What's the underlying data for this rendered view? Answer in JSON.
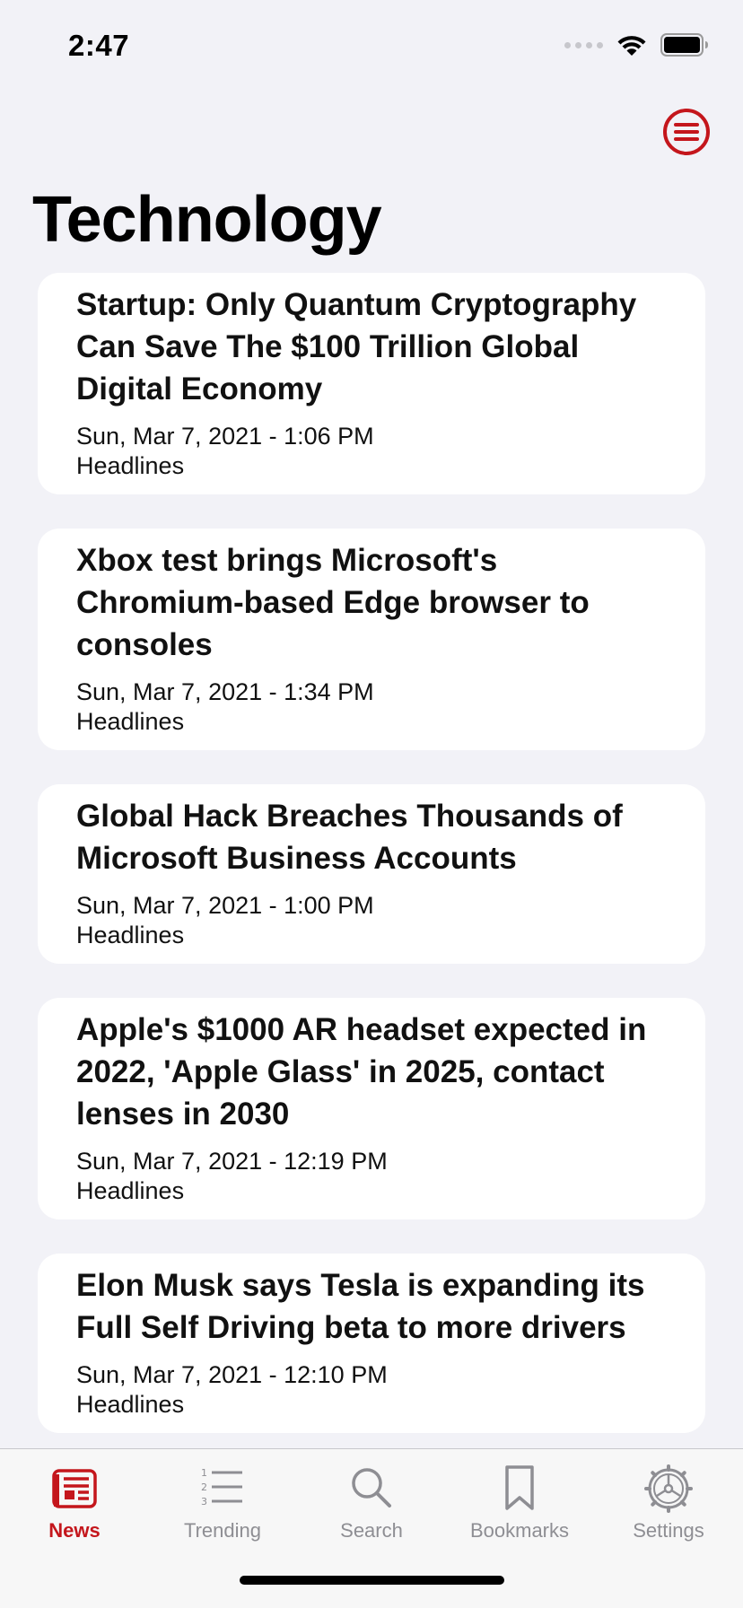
{
  "status_bar": {
    "time": "2:47"
  },
  "page": {
    "title": "Technology"
  },
  "articles": [
    {
      "title": "Startup: Only Quantum Cryptography Can Save The $100 Trillion Global Digital Economy",
      "date": "Sun, Mar 7, 2021 - 1:06 PM",
      "source": "Headlines"
    },
    {
      "title": "Xbox test brings Microsoft's Chromium-based Edge browser to consoles",
      "date": "Sun, Mar 7, 2021 - 1:34 PM",
      "source": "Headlines"
    },
    {
      "title": "Global Hack Breaches Thousands of Microsoft Business Accounts",
      "date": "Sun, Mar 7, 2021 - 1:00 PM",
      "source": "Headlines"
    },
    {
      "title": "Apple's $1000 AR headset expected in 2022, 'Apple Glass' in 2025, contact lenses in 2030",
      "date": "Sun, Mar 7, 2021 - 12:19 PM",
      "source": "Headlines"
    },
    {
      "title": "Elon Musk says Tesla is expanding its Full Self Driving beta to more drivers",
      "date": "Sun, Mar 7, 2021 - 12:10 PM",
      "source": "Headlines"
    }
  ],
  "tabs": [
    {
      "label": "News",
      "icon": "newspaper-icon",
      "active": true
    },
    {
      "label": "Trending",
      "icon": "numbered-list-icon",
      "active": false
    },
    {
      "label": "Search",
      "icon": "magnifier-icon",
      "active": false
    },
    {
      "label": "Bookmarks",
      "icon": "bookmark-icon",
      "active": false
    },
    {
      "label": "Settings",
      "icon": "gear-icon",
      "active": false
    }
  ],
  "colors": {
    "accent": "#c4161c",
    "inactive": "#8e8e93",
    "background": "#f2f2f7"
  }
}
